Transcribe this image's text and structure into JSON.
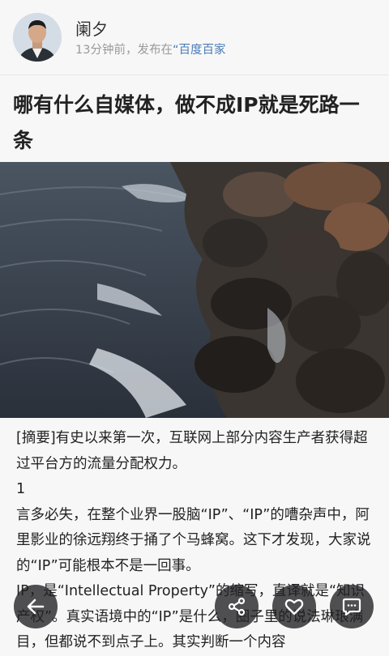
{
  "author": {
    "name": "阑夕",
    "time": "13分钟前",
    "published_prefix": "，发布在",
    "source": "“百度百家"
  },
  "article": {
    "title": "哪有什么自媒体，做不成IP就是死路一条",
    "paragraphs": [
      "[摘要]有史以来第一次，互联网上部分内容生产者获得超过平台方的流量分配权力。",
      "1",
      "言多必失，在整个业界一股脑“IP”、“IP”的嘈杂声中，阿里影业的徐远翔终于捅了个马蜂窝。这下才发现，大家说的“IP”可能根本不是一回事。",
      "IP，是“Intellectual Property”的缩写，直译就是“知识产权”。真实语境中的“IP”是什么，圈子里的说法琳琅满目，但都说不到点子上。其实判断一个内容"
    ]
  },
  "actions": {
    "back": "back-icon",
    "share": "share-icon",
    "like": "heart-icon",
    "comment": "comment-icon"
  }
}
